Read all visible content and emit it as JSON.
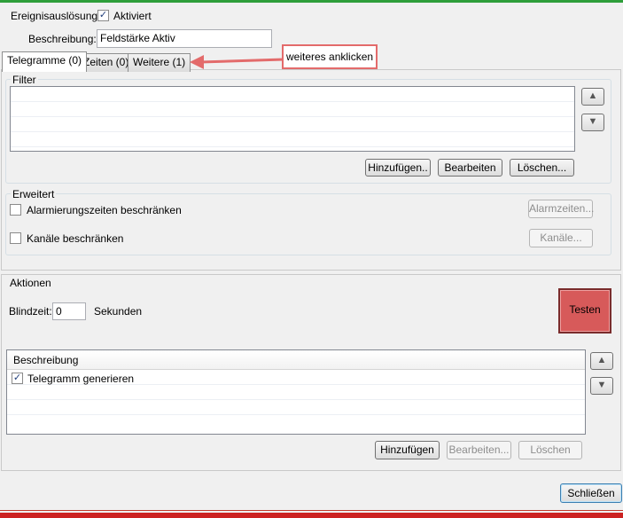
{
  "general": {
    "trigger_label": "Ereignisauslösung:",
    "activated_label": "Aktiviert",
    "activated_checked": true,
    "description_label": "Beschreibung:",
    "description_value": "Feldstärke Aktiv"
  },
  "tabs": [
    {
      "label": "Telegramme (0)",
      "active": true
    },
    {
      "label": "Zeiten (0)",
      "active": false
    },
    {
      "label": "Weitere (1)",
      "active": false
    }
  ],
  "annotation": {
    "text": "weiteres anklicken",
    "color": "#e36b6b"
  },
  "filter": {
    "title": "Filter",
    "buttons": {
      "add": "Hinzufügen..",
      "edit": "Bearbeiten",
      "delete": "Löschen..."
    }
  },
  "extended": {
    "title": "Erweitert",
    "alarm_times_label": "Alarmierungszeiten beschränken",
    "alarm_times_button": "Alarmzeiten...",
    "channels_label": "Kanäle beschränken",
    "channels_button": "Kanäle..."
  },
  "actions": {
    "title": "Aktionen",
    "blind_time_label": "Blindzeit:",
    "blind_time_value": "0",
    "seconds_label": "Sekunden",
    "test_button": "Testen",
    "test_color": "#d75a5a",
    "list_header": "Beschreibung",
    "items": [
      {
        "label": "Telegramm generieren",
        "checked": true
      }
    ],
    "buttons": {
      "add": "Hinzufügen",
      "edit": "Bearbeiten...",
      "delete": "Löschen"
    }
  },
  "footer": {
    "close_button": "Schließen"
  },
  "icons": {
    "up": "arrow-up-icon",
    "down": "arrow-down-icon",
    "check": "checkmark-icon"
  }
}
